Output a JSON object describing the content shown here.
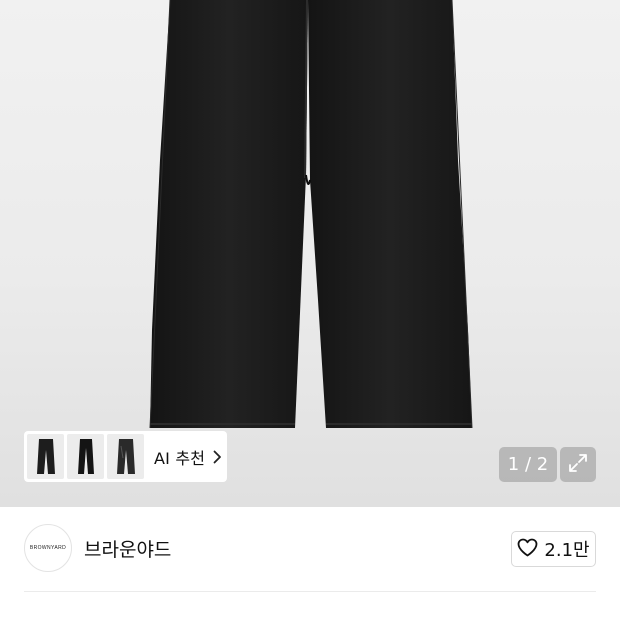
{
  "gallery": {
    "ai_recommend_label": "AI 추천",
    "counter": "1 / 2",
    "thumbnail_count": 3
  },
  "brand": {
    "logo_text": "BROWNYARD",
    "name": "브라운야드"
  },
  "like": {
    "count": "2.1만"
  },
  "icons": {
    "chevron": "chevron-right-icon",
    "expand": "expand-icon",
    "heart": "heart-outline-icon"
  },
  "colors": {
    "product": "#1c1c1c",
    "overlay": "#969696"
  }
}
